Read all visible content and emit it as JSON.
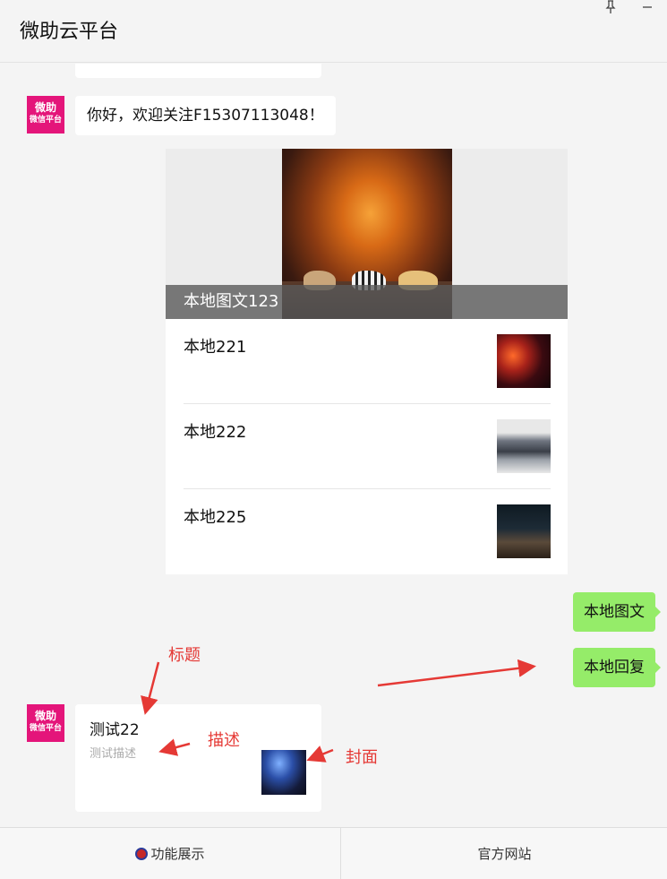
{
  "window": {
    "title": "微助云平台",
    "pin_icon": "pin-icon",
    "minimize_icon": "minimize-icon"
  },
  "avatar": {
    "line1": "微助",
    "line2": "微信平台",
    "color": "#e4157a"
  },
  "messages": {
    "welcome": "你好，欢迎关注F15307113048！",
    "news": {
      "cover_title": "本地图文123",
      "items": [
        {
          "title": "本地221"
        },
        {
          "title": "本地222"
        },
        {
          "title": "本地225"
        }
      ]
    },
    "sent": [
      "本地图文",
      "本地回复"
    ],
    "link_card": {
      "title": "测试22",
      "description": "测试描述"
    }
  },
  "annotations": {
    "title": "标题",
    "description": "描述",
    "cover": "封面",
    "color": "#e53935"
  },
  "bottom_bar": {
    "left_tab": "功能展示",
    "right_tab": "官方网站"
  },
  "colors": {
    "sent_bubble": "#95ec69",
    "background": "#f4f4f4"
  }
}
